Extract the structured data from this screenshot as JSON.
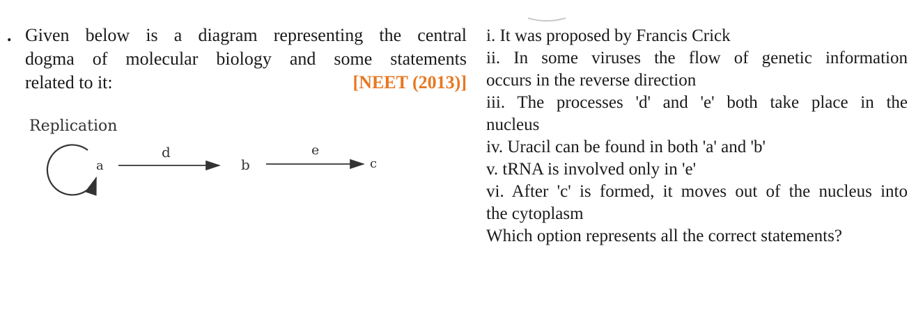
{
  "question": {
    "bullet": ".",
    "line1": "Given below is a diagram representing the central",
    "line2": "dogma of molecular biology and some statements",
    "line3": "related to it:",
    "exam_tag": "[NEET (2013)]"
  },
  "diagram": {
    "replication_label": "Replication",
    "node_a": "a",
    "node_b": "b",
    "node_c": "c",
    "process_d": "d",
    "process_e": "e"
  },
  "statements": {
    "s1": "i. It was proposed by Francis Crick",
    "s2_line1": "ii. In some viruses the flow of genetic information",
    "s2_line2": "occurs in the reverse direction",
    "s3_line1": "iii. The processes 'd' and 'e' both take place in the",
    "s3_line2": "nucleus",
    "s4": "iv. Uracil can be found in both 'a' and 'b'",
    "s5": "v. tRNA is involved only in 'e'",
    "s6_line1": "vi. After 'c' is formed, it moves out of the nucleus into",
    "s6_line2": "the cytoplasm",
    "prompt": "Which option represents all the correct statements?"
  }
}
